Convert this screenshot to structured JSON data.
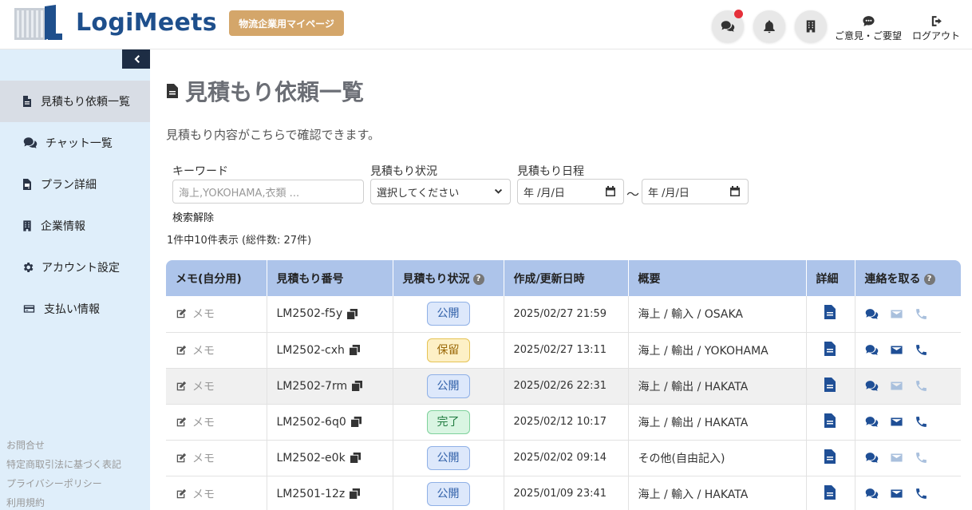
{
  "header": {
    "brand": "LogiMeets",
    "portal_badge": "物流企業用マイページ",
    "feedback_label": "ご意見・ご要望",
    "logout_label": "ログアウト"
  },
  "sidebar": {
    "items": [
      {
        "label": "見積もり依頼一覧",
        "icon": "file-icon"
      },
      {
        "label": "チャット一覧",
        "icon": "chat-icon"
      },
      {
        "label": "プラン詳細",
        "icon": "file-invoice-icon"
      },
      {
        "label": "企業情報",
        "icon": "building-icon"
      },
      {
        "label": "アカウント設定",
        "icon": "gear-icon"
      },
      {
        "label": "支払い情報",
        "icon": "credit-card-icon"
      }
    ],
    "footer_links": [
      "お問合せ",
      "特定商取引法に基づく表記",
      "プライバシーポリシー",
      "利用規約"
    ]
  },
  "page": {
    "title": "見積もり依頼一覧",
    "description": "見積もり内容がこちらで確認できます。"
  },
  "filters": {
    "keyword_label": "キーワード",
    "keyword_placeholder": "海上,YOKOHAMA,衣類 ...",
    "status_label": "見積もり状況",
    "status_value": "選択してください",
    "date_label": "見積もり日程",
    "date_from": "年 /月/日",
    "date_to": "年 /月/日",
    "tilde": "～",
    "clear_label": "検索解除"
  },
  "count_text": "1件中10件表示 (総件数: 27件)",
  "table": {
    "headers": {
      "memo": "メモ(自分用)",
      "number": "見積もり番号",
      "status": "見積もり状況",
      "date": "作成/更新日時",
      "summary": "概要",
      "detail": "詳細",
      "contact": "連絡を取る"
    },
    "help_glyph": "?",
    "rows": [
      {
        "memo": "メモ",
        "number": "LM2502-f5y",
        "status": "公開",
        "date": "2025/02/27 21:59",
        "summary": "海上 / 輸入 / OSAKA"
      },
      {
        "memo": "メモ",
        "number": "LM2502-cxh",
        "status": "保留",
        "date": "2025/02/27 13:11",
        "summary": "海上 / 輸出 / YOKOHAMA"
      },
      {
        "memo": "メモ",
        "number": "LM2502-7rm",
        "status": "公開",
        "date": "2025/02/26 22:31",
        "summary": "海上 / 輸出 / HAKATA"
      },
      {
        "memo": "メモ",
        "number": "LM2502-6q0",
        "status": "完了",
        "date": "2025/02/12 10:17",
        "summary": "海上 / 輸出 / HAKATA"
      },
      {
        "memo": "メモ",
        "number": "LM2502-e0k",
        "status": "公開",
        "date": "2025/02/02 09:14",
        "summary": "その他(自由記入)"
      },
      {
        "memo": "メモ",
        "number": "LM2501-12z",
        "status": "公開",
        "date": "2025/01/09 23:41",
        "summary": "海上 / 輸入 / HAKATA"
      }
    ]
  },
  "colors": {
    "brand": "#1e4f8c",
    "badge": "#d4a66a",
    "sidebar_bg": "#dfeefa",
    "table_header": "#adc4ea",
    "status_public": "#dde8fb",
    "status_hold": "#fdf0c6",
    "status_done": "#d9f5e2",
    "notification_dot": "#e5303a"
  }
}
